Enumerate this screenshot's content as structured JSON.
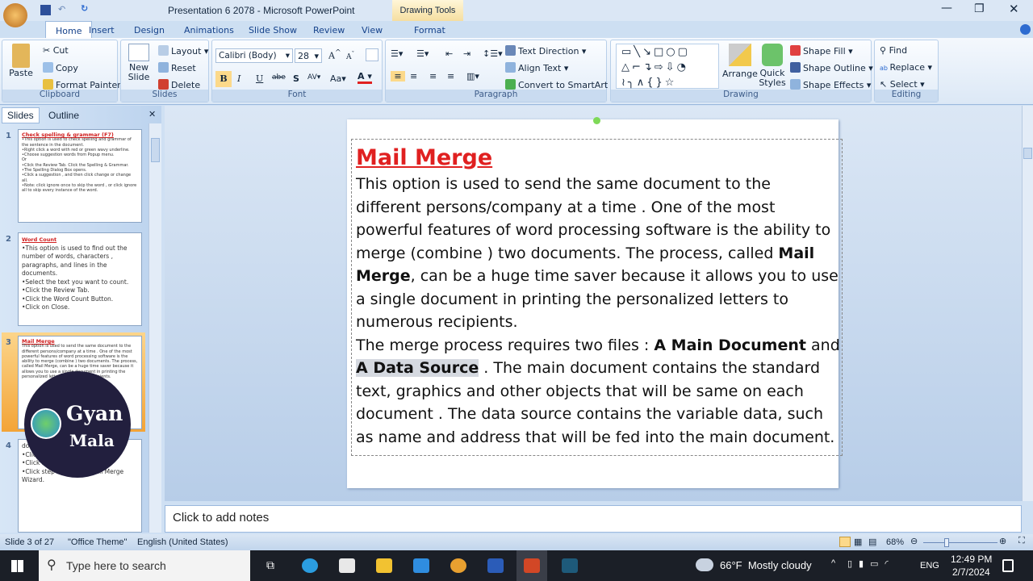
{
  "window": {
    "title": "Presentation 6 2078 - Microsoft PowerPoint",
    "contextual": "Drawing Tools"
  },
  "tabs": [
    "Home",
    "Insert",
    "Design",
    "Animations",
    "Slide Show",
    "Review",
    "View",
    "Format"
  ],
  "clipboard": {
    "paste": "Paste",
    "cut": "Cut",
    "copy": "Copy",
    "format_painter": "Format Painter",
    "label": "Clipboard"
  },
  "slides_group": {
    "new_slide": "New Slide",
    "layout": "Layout",
    "reset": "Reset",
    "delete": "Delete",
    "label": "Slides"
  },
  "font": {
    "name": "Calibri (Body)",
    "size": "28",
    "label": "Font"
  },
  "paragraph": {
    "text_direction": "Text Direction",
    "align_text": "Align Text",
    "convert": "Convert to SmartArt",
    "label": "Paragraph"
  },
  "drawing": {
    "arrange": "Arrange",
    "quick_styles": "Quick Styles",
    "shape_fill": "Shape Fill",
    "shape_outline": "Shape Outline",
    "shape_effects": "Shape Effects",
    "label": "Drawing"
  },
  "editing": {
    "find": "Find",
    "replace": "Replace",
    "select": "Select",
    "label": "Editing"
  },
  "pane_tabs": {
    "slides": "Slides",
    "outline": "Outline"
  },
  "thumbnails": [
    {
      "num": "1",
      "title": "Check spelling & grammar (F7)",
      "body": [
        "•This option is used to check spelling and grammar of the sentence in the document.",
        "•Right click a word with red or green wavy underline.",
        "•Choose suggestion words from Popup menu.",
        "Or",
        "•Click the Review Tab. Click the Spelling & Grammar.",
        "•The Spelling Dialog Box opens.",
        "•Click a suggestion , and then click change or change all.",
        "•Note: click ignore once to skip the word , or click ignore all to skip every instance of the word."
      ]
    },
    {
      "num": "2",
      "title": "Word Count",
      "body": [
        "•This option is used to find out the number of words, characters , paragraphs, and lines in the documents.",
        "•Select the text you want to count.",
        "•Click the Review Tab.",
        "•Click the Word Count Button.",
        "•Click on Close."
      ]
    },
    {
      "num": "3",
      "title": "Mail Merge",
      "body": [
        "This option is used to send the same document to the different persons/company at a time . One of the most powerful features of word processing software is the ability to merge (combine ) two documents. The process, called Mail Merge, can be a huge time saver because it allows you to use a single document in printing the personalized letters to numerous recipients."
      ]
    },
    {
      "num": "4",
      "title": "",
      "body": [
        "do...",
        "•Click ...",
        "•Click Start Mail Merge.",
        "•Click step by step by Mail Merge Wizard."
      ]
    }
  ],
  "logo": {
    "line1": "Gyan",
    "line2": "Mala"
  },
  "slide": {
    "title": "Mail Merge",
    "p1": [
      {
        "t": "This option is used to send the same document to the different persons/company at a time . One of the most powerful features of word processing software is the ability to merge (combine ) two documents. The process, called "
      },
      {
        "t": "Mail Merge",
        "b": true
      },
      {
        "t": ", can be a huge time saver because it allows you to use a single document in printing the personalized letters to numerous recipients."
      }
    ],
    "p2": [
      {
        "t": "The merge process requires two files : "
      },
      {
        "t": "A Main Document",
        "b": true
      },
      {
        "t": " and "
      },
      {
        "t": "A Data Source",
        "b": true,
        "h": true
      },
      {
        "t": " . The main document contains the standard text, graphics and other objects that will be same on each document . The data source contains the variable data, such as name and address that will be fed into the main document."
      }
    ]
  },
  "notes": {
    "placeholder": "Click to add notes"
  },
  "status": {
    "slide": "Slide 3 of 27",
    "theme": "\"Office Theme\"",
    "language": "English (United States)",
    "zoom": "68%"
  },
  "taskbar": {
    "search": "Type here to search",
    "weather": "66°F  Mostly cloudy",
    "lang": "ENG",
    "time": "12:49 PM",
    "date": "2/7/2024"
  }
}
